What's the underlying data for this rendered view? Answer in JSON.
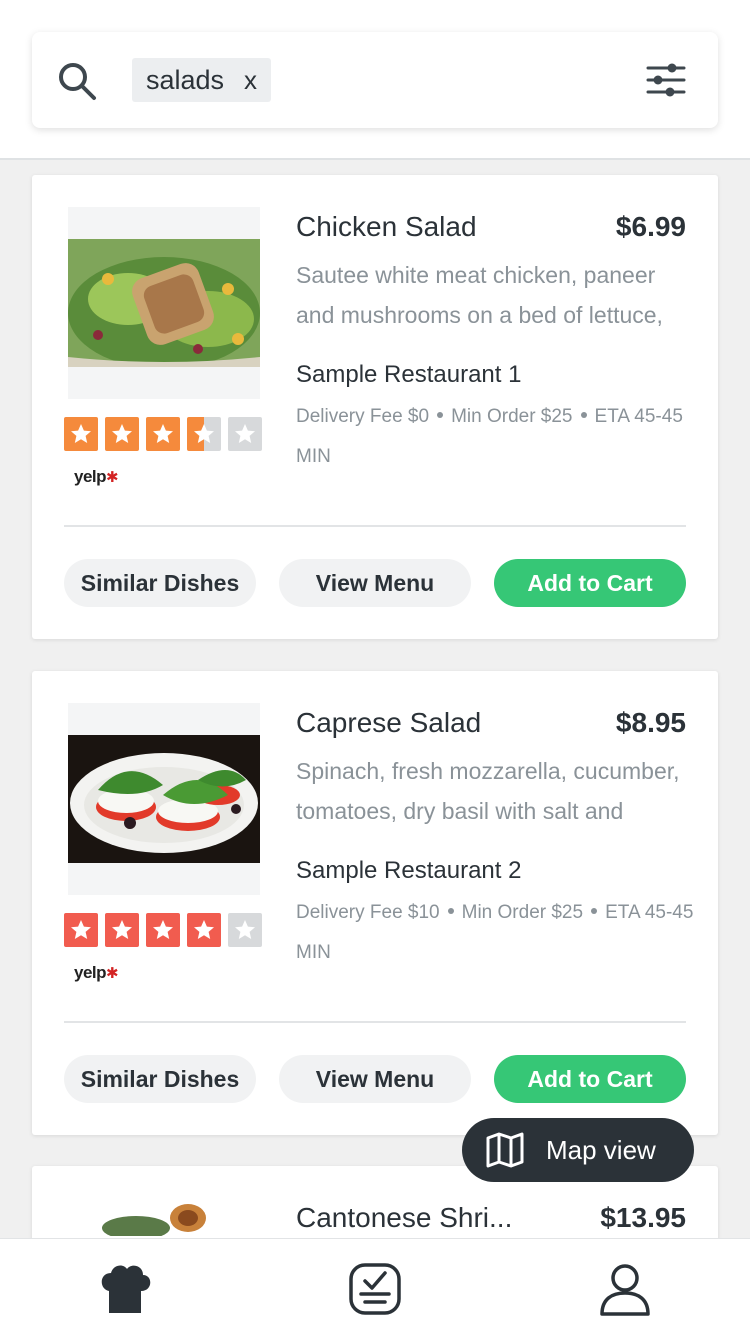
{
  "search": {
    "chip_label": "salads",
    "chip_remove": "x"
  },
  "colors": {
    "accent_green": "#36c776",
    "dark": "#2b3238",
    "star_orange": "#f58a3c",
    "star_red": "#f15c4f",
    "star_empty": "#d7d9db"
  },
  "dishes": [
    {
      "title": "Chicken Salad",
      "price": "$6.99",
      "description": "Sautee white meat chicken, paneer and mushrooms on a bed of lettuce,",
      "restaurant": "Sample Restaurant 1",
      "delivery_fee": "Delivery Fee $0",
      "min_order": "Min Order $25",
      "eta": "ETA 45-45 MIN",
      "rating": 3.5,
      "rating_source": "yelp",
      "buttons": {
        "similar": "Similar Dishes",
        "menu": "View Menu",
        "cart": "Add to Cart"
      }
    },
    {
      "title": "Caprese Salad",
      "price": "$8.95",
      "description": "Spinach, fresh mozzarella, cucumber, tomatoes, dry basil with salt and",
      "restaurant": "Sample Restaurant 2",
      "delivery_fee": "Delivery Fee $10",
      "min_order": "Min Order $25",
      "eta": "ETA 45-45 MIN",
      "rating": 4,
      "rating_source": "yelp",
      "buttons": {
        "similar": "Similar Dishes",
        "menu": "View Menu",
        "cart": "Add to Cart"
      }
    },
    {
      "title": "Cantonese Shri...",
      "price": "$13.95"
    }
  ],
  "map_button": {
    "label": "Map view",
    "icon": "map-icon"
  },
  "bottom_nav": [
    {
      "icon": "chef-hat-icon"
    },
    {
      "icon": "order-checklist-icon"
    },
    {
      "icon": "profile-icon"
    }
  ]
}
